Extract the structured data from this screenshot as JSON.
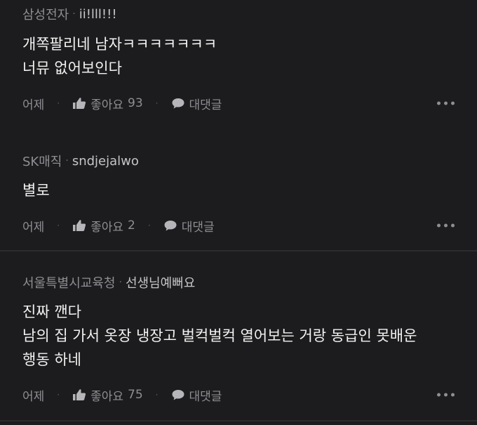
{
  "comments": [
    {
      "company": "삼성전자",
      "nickname": "ii!lll!!!",
      "lines": [
        "개쪽팔리네 남자ㅋㅋㅋㅋㅋㅋㅋ",
        "너뮤 없어보인다"
      ],
      "time": "어제",
      "like_label": "좋아요",
      "like_count": "93",
      "reply_label": "대댓글"
    },
    {
      "company": "SK매직",
      "nickname": "sndjejalwo",
      "lines": [
        "별로"
      ],
      "time": "어제",
      "like_label": "좋아요",
      "like_count": "2",
      "reply_label": "대댓글"
    },
    {
      "company": "서울특별시교육청",
      "nickname": "선생님예뻐요",
      "lines": [
        "진짜 깬다",
        "남의 집 가서 옷장 냉장고 벌컥벌컥 열어보는 거랑 동급인 못배운",
        "행동 하네"
      ],
      "time": "어제",
      "like_label": "좋아요",
      "like_count": "75",
      "reply_label": "대댓글"
    }
  ],
  "icons": {
    "like": "thumbs-up-icon",
    "reply": "speech-bubble-icon",
    "more": "more-dots-icon"
  },
  "colors": {
    "background": "#1c1c1e",
    "muted": "#8e8e93",
    "text": "#f2f2f2"
  }
}
